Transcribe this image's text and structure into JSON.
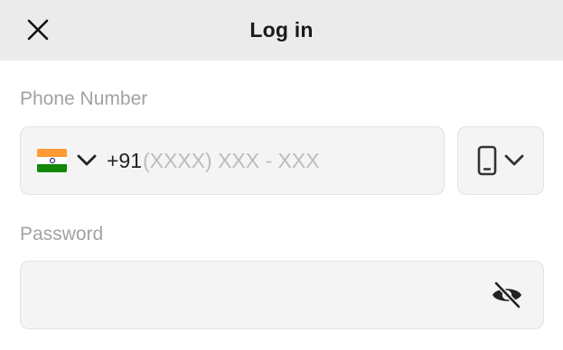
{
  "header": {
    "title": "Log in",
    "close_icon": "close-icon"
  },
  "phone": {
    "label": "Phone Number",
    "country_flag": "india-flag-icon",
    "dial_code": "+91",
    "value": "",
    "placeholder": "(XXXX) XXX - XXX",
    "device_icon": "mobile-phone-icon"
  },
  "password": {
    "label": "Password",
    "value": "",
    "toggle_icon": "eye-slash-icon"
  },
  "colors": {
    "header_bg": "#ebebeb",
    "field_bg": "#f4f4f4",
    "label": "#a2a2a2",
    "placeholder": "#bcbcbc"
  }
}
